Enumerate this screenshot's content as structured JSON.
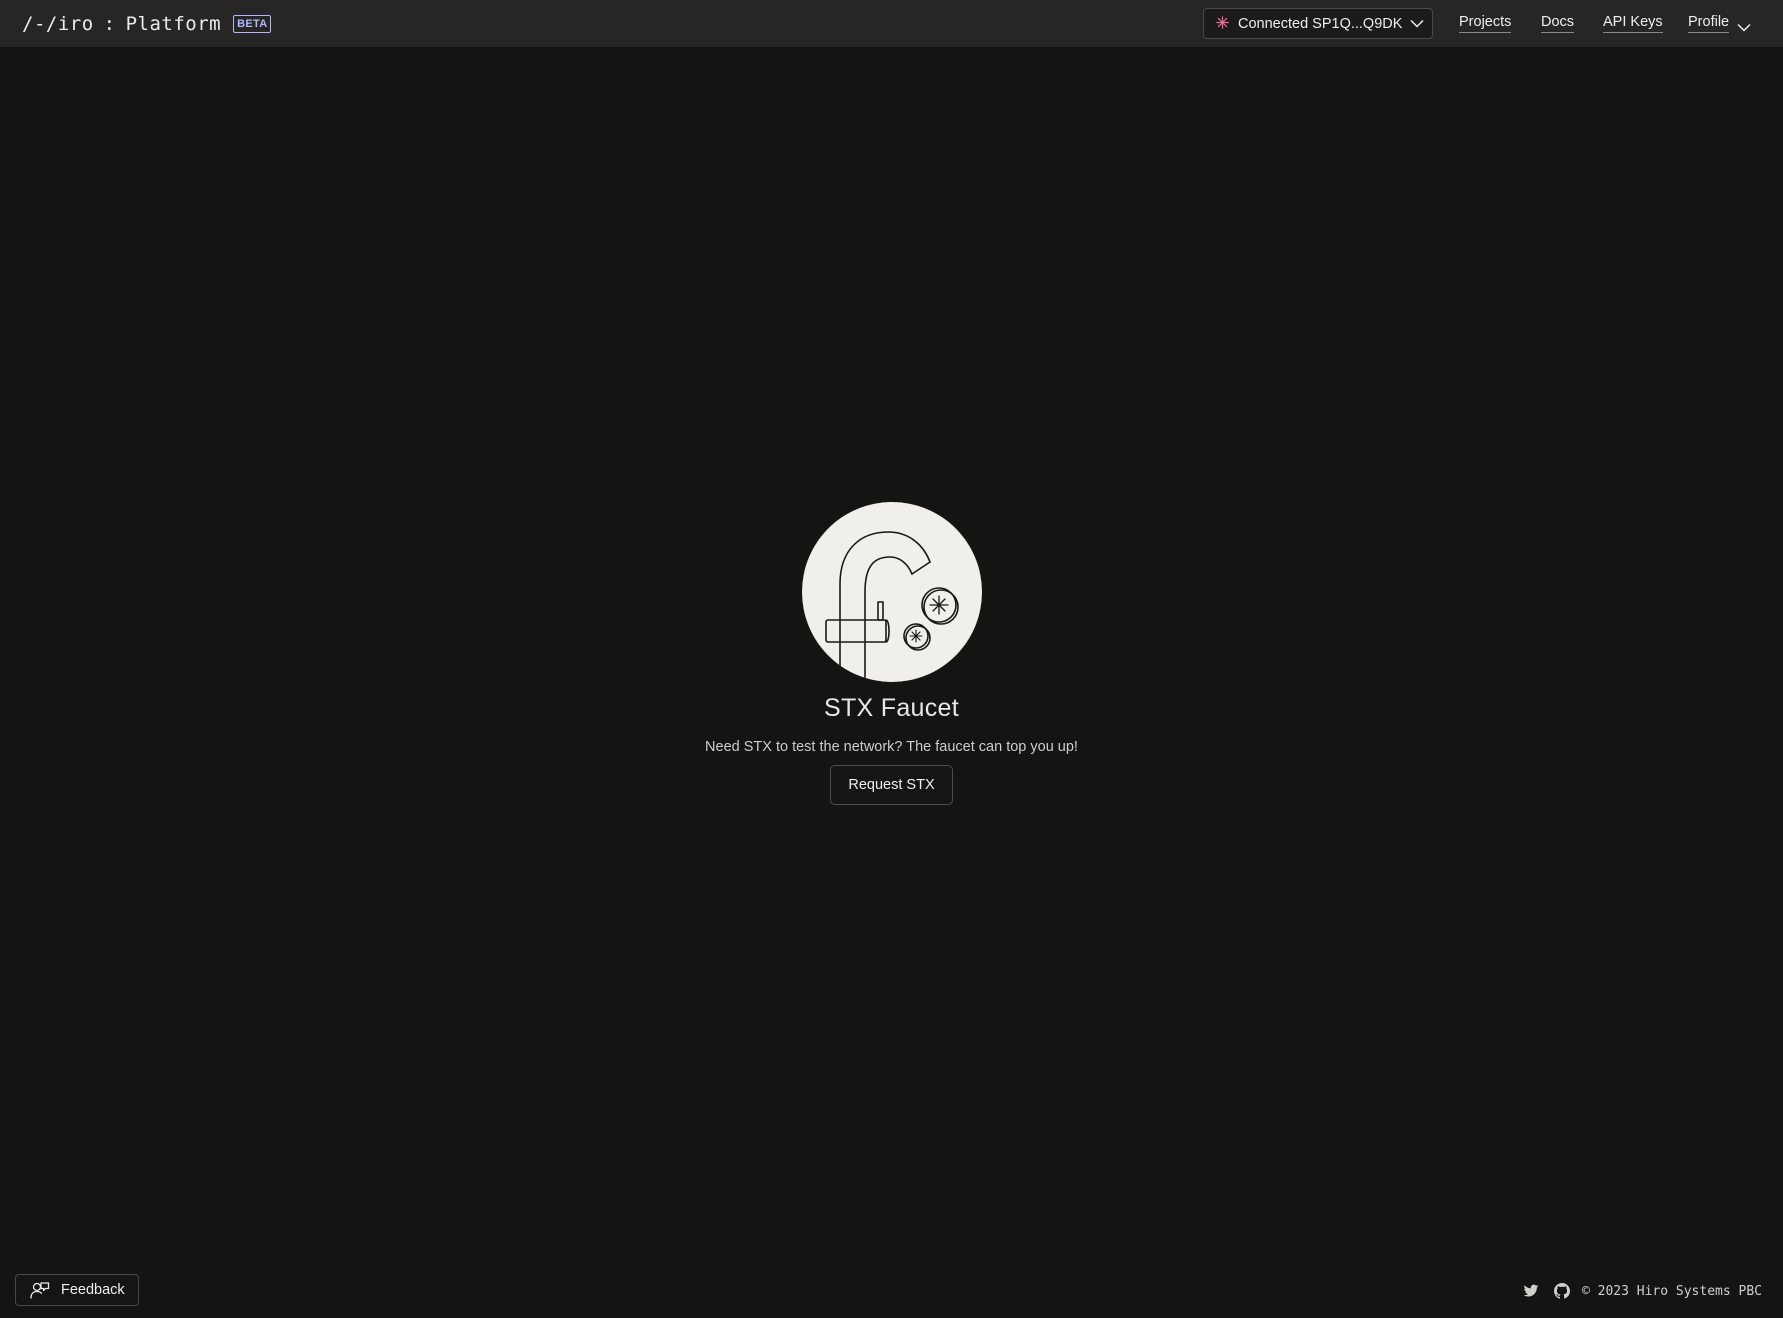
{
  "header": {
    "brand_logo": "/-/iro",
    "brand_sep": ":",
    "brand_product": "Platform",
    "beta_badge": "BETA",
    "wallet_label": "Connected SP1Q...Q9DK",
    "nav": {
      "projects": "Projects",
      "docs": "Docs",
      "api_keys": "API Keys",
      "profile": "Profile"
    }
  },
  "main": {
    "title": "STX Faucet",
    "subtitle": "Need STX to test the network? The faucet can top you up!",
    "button_label": "Request STX"
  },
  "footer": {
    "feedback_label": "Feedback",
    "copyright": "© 2023 Hiro Systems PBC"
  },
  "icons": {
    "wallet": "stacks-spark-icon",
    "dropdown": "chevron-down-icon",
    "feedback": "feedback-person-icon",
    "social": [
      "twitter-icon",
      "github-icon"
    ]
  },
  "colors": {
    "background": "#141413",
    "header": "#272625",
    "beta": "#aeb9ff",
    "spark": "#e36a8f",
    "illustration_bg": "#f1efea"
  }
}
